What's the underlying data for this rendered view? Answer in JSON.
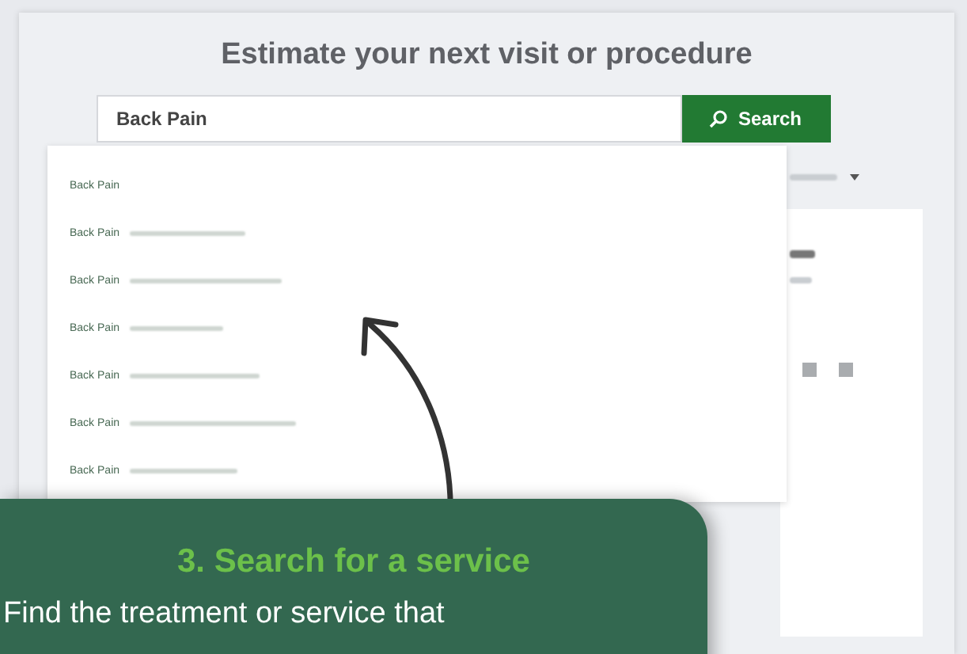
{
  "page": {
    "title": "Estimate your next visit or procedure"
  },
  "search": {
    "value": "Back Pain",
    "button": "Search"
  },
  "suggestions": [
    {
      "label": "Back Pain",
      "kind": "plain"
    },
    {
      "label": "Back Pain",
      "kind": "detailed"
    },
    {
      "label": "Back Pain",
      "kind": "detailed"
    },
    {
      "label": "Back Pain",
      "kind": "detailed"
    },
    {
      "label": "Back Pain",
      "kind": "detailed"
    },
    {
      "label": "Back Pain",
      "kind": "detailed"
    },
    {
      "label": "Back Pain",
      "kind": "detailed"
    }
  ],
  "callout": {
    "title": "3. Search for a service",
    "text": "Find the treatment or service that"
  }
}
